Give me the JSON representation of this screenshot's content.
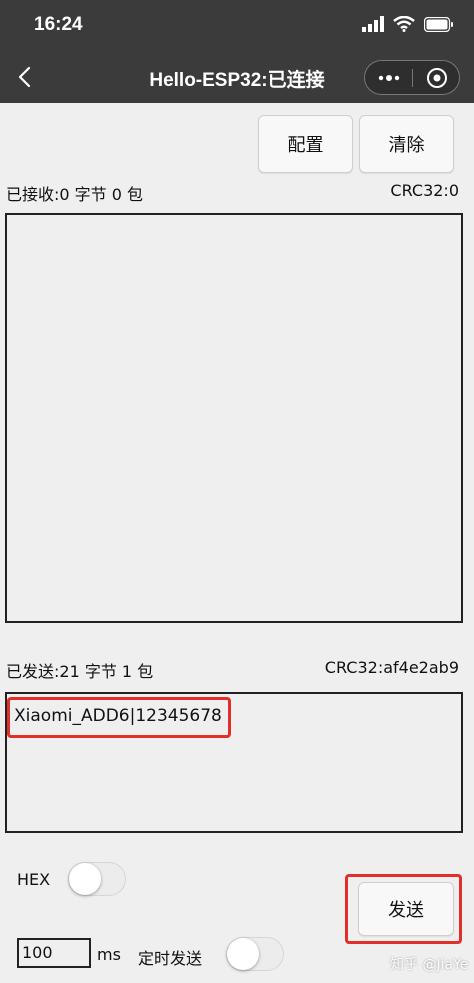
{
  "status_bar": {
    "time": "16:24",
    "icons": [
      "signal-icon",
      "wifi-icon",
      "battery-icon"
    ]
  },
  "nav": {
    "title": "Hello-ESP32:已连接",
    "icons": [
      "back-arrow-icon",
      "more-dots-icon",
      "target-close-icon"
    ]
  },
  "toolbar": {
    "config_label": "配置",
    "clear_label": "清除"
  },
  "receive": {
    "stats": "已接收:0 字节 0 包",
    "crc": "CRC32:0",
    "content": ""
  },
  "send": {
    "stats": "已发送:21 字节 1 包",
    "crc": "CRC32:af4e2ab9",
    "content": "Xiaomi_ADD6|12345678",
    "highlight_color": "#e0302a"
  },
  "controls": {
    "hex_label": "HEX",
    "hex_on": false,
    "interval_value": "100",
    "interval_unit": "ms",
    "timer_label": "定时发送",
    "timer_on": false,
    "send_label": "发送"
  },
  "watermark": "知乎 @JiaYe"
}
